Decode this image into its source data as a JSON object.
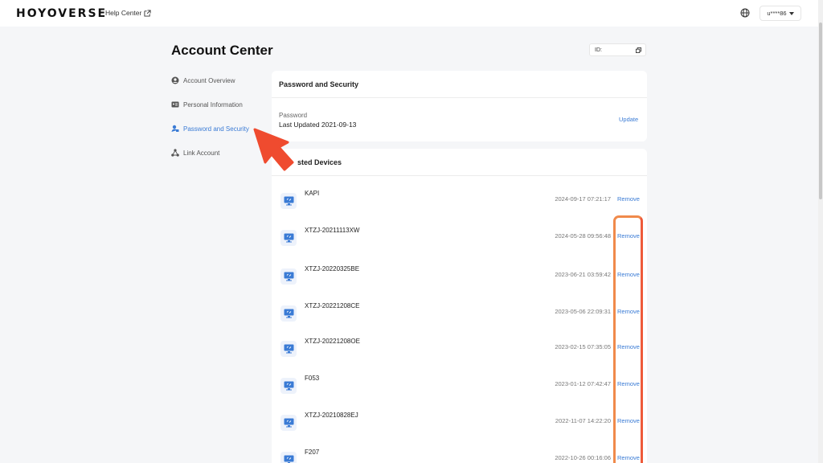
{
  "header": {
    "logo": "HOYOVERSE",
    "help_center": "Help Center",
    "user": "u****86"
  },
  "page": {
    "title": "Account Center",
    "id_label": "ID:"
  },
  "sidebar": {
    "items": [
      {
        "label": "Account Overview",
        "icon": "user-circle-icon"
      },
      {
        "label": "Personal Information",
        "icon": "id-card-icon"
      },
      {
        "label": "Password and Security",
        "icon": "shield-lock-icon",
        "active": true
      },
      {
        "label": "Link Account",
        "icon": "link-account-icon"
      }
    ]
  },
  "password_card": {
    "title": "Password and Security",
    "password_label": "Password",
    "last_updated": "Last Updated 2021-09-13",
    "update_label": "Update"
  },
  "devices_card": {
    "title": "Trusted Devices",
    "visible_title": "sted Devices",
    "remove_label": "Remove",
    "devices": [
      {
        "name": "KAPI",
        "time": "2024-09-17 07:21:17"
      },
      {
        "name": "XTZJ-20211113XW",
        "time": "2024-05-28 09:56:48"
      },
      {
        "name": "XTZJ-20220325BE",
        "time": "2023-06-21 03:59:42"
      },
      {
        "name": "XTZJ-20221208CE",
        "time": "2023-05-06 22:09:31"
      },
      {
        "name": "XTZJ-20221208OE",
        "time": "2023-02-15 07:35:05"
      },
      {
        "name": "F053",
        "time": "2023-01-12 07:42:47"
      },
      {
        "name": "XTZJ-20210828EJ",
        "time": "2022-11-07 14:22:20"
      },
      {
        "name": "F207",
        "time": "2022-10-26 00:16:06"
      }
    ]
  },
  "colors": {
    "accent": "#3a7bd5",
    "annotation_arrow": "#ef4b2f",
    "annotation_box_top": "#f08a4b",
    "annotation_box_bottom": "#e2303a"
  }
}
